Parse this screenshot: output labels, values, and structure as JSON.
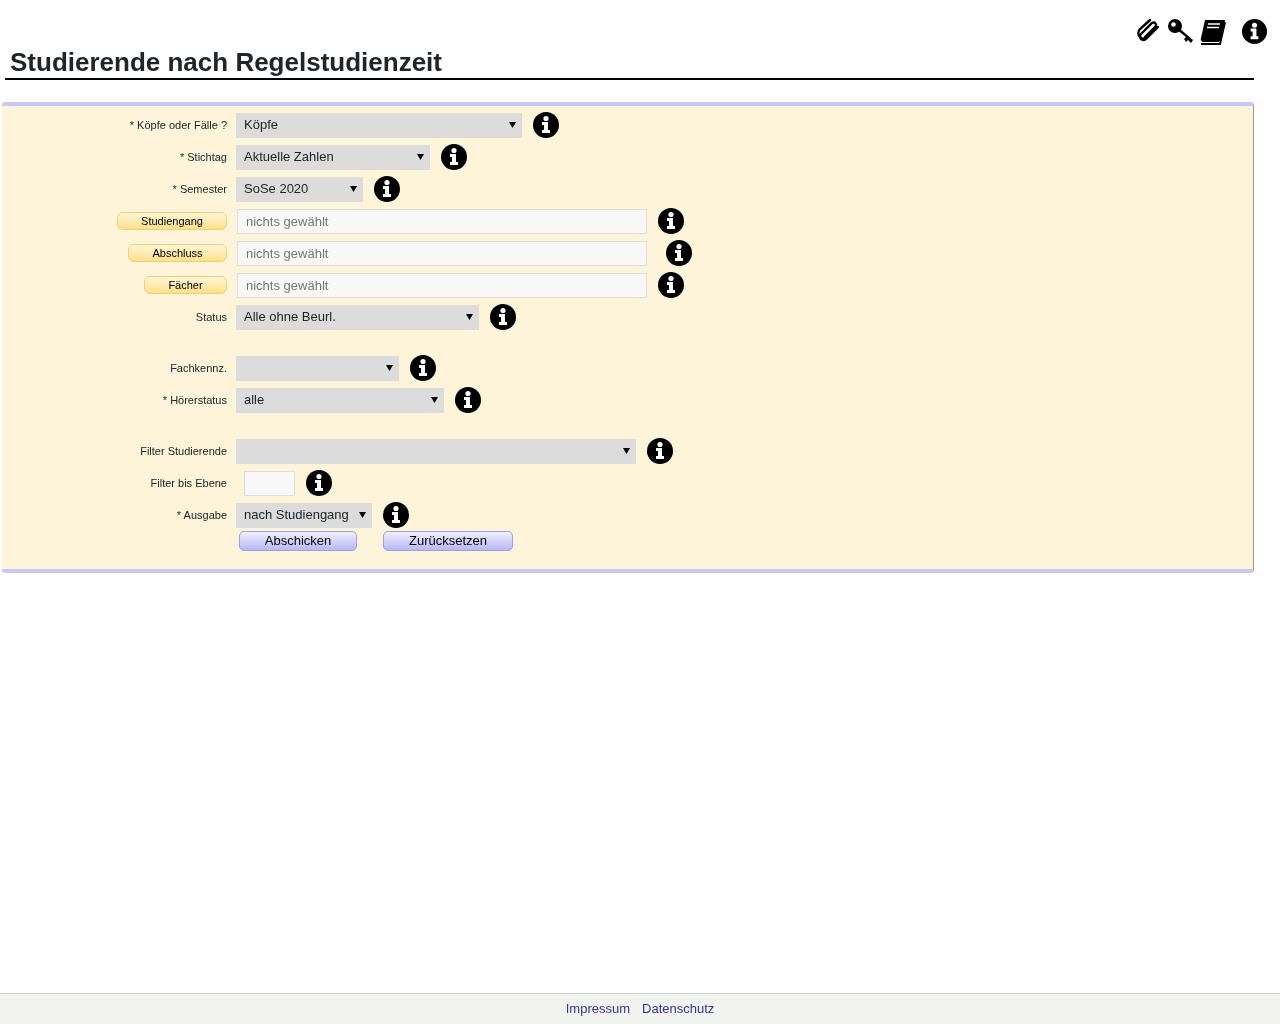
{
  "page": {
    "title": "Studierende nach Regelstudienzeit"
  },
  "form": {
    "fields": [
      {
        "kind": "select",
        "label": "* Köpfe oder Fälle ?",
        "value": "Köpfe"
      },
      {
        "kind": "select",
        "label": "* Stichtag",
        "value": "Aktuelle Zahlen"
      },
      {
        "kind": "select",
        "label": "* Semester",
        "value": "SoSe 2020"
      },
      {
        "kind": "picker",
        "label": "Studiengang",
        "placeholder": "nichts gewählt"
      },
      {
        "kind": "picker",
        "label": "Abschluss",
        "placeholder": "nichts gewählt"
      },
      {
        "kind": "picker",
        "label": "Fächer",
        "placeholder": "nichts gewählt"
      },
      {
        "kind": "select",
        "label": "Status",
        "value": "Alle ohne Beurl."
      },
      {
        "kind": "select",
        "label": "Fachkennz.",
        "spaced": true
      },
      {
        "kind": "select",
        "label": "* Hörerstatus",
        "value": "alle"
      },
      {
        "kind": "select",
        "label": "Filter Studierende",
        "spaced": true
      },
      {
        "kind": "text",
        "label": "Filter bis Ebene"
      },
      {
        "kind": "select",
        "label": "* Ausgabe",
        "value": "nach Studiengang"
      }
    ],
    "buttons": [
      "Abschicken",
      "Zurücksetzen"
    ]
  },
  "footer": {
    "links": [
      "Impressum",
      "Datenschutz"
    ]
  }
}
